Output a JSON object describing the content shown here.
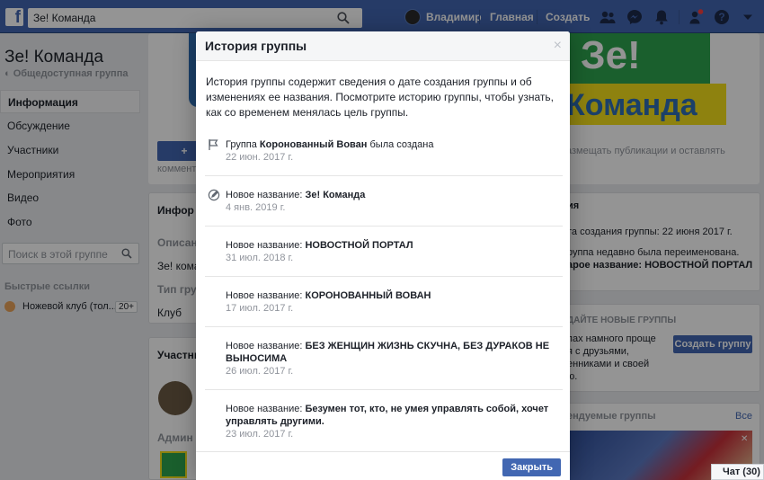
{
  "topbar": {
    "search_value": "Зе! Команда",
    "user_name": "Владимир",
    "home_label": "Главная",
    "create_label": "Создать"
  },
  "left": {
    "group_title": "Зе! Команда",
    "group_type": "Общедоступная группа",
    "nav": [
      "Информация",
      "Обсуждение",
      "Участники",
      "Мероприятия",
      "Видео",
      "Фото"
    ],
    "search_placeholder": "Поиск в этой группе",
    "quick_links_title": "Быстрые ссылки",
    "quick_item": "Ножевой клуб (тол...",
    "quick_badge": "20+"
  },
  "background": {
    "cover_text_top": "Зе!",
    "cover_text_bottom": "Команда",
    "add_btn": "+",
    "comments": "коммент",
    "publish_hint": "азмещать публикации и оставлять",
    "info_card_title": "Инфор",
    "descr_label": "Описан",
    "descr_value": "Зе! кома",
    "type_label": "Тип гру",
    "type_value": "Клуб",
    "members_title": "Участни",
    "admins": "Админ",
    "history_title": "ия",
    "created_line": "та создания группы: 22 июня 2017 г.",
    "renamed_line1": "руппа недавно была переименована.",
    "renamed_line2": "арое название: НОВОСТНОЙ ПОРТАЛ",
    "suggest_title": "ДАЙТЕ НОВЫЕ ГРУППЫ",
    "suggest_l1": "пах намного проще",
    "suggest_l2": "я с друзьями,",
    "suggest_l3": "енниками и своей",
    "suggest_l4": "ю.",
    "create_group_btn": "Создать группу",
    "recommended_title": "ендуемые группы",
    "all_link": "Все",
    "chat_label": "Чат (30)"
  },
  "dialog": {
    "title": "История группы",
    "close": "×",
    "intro": "История группы содержит сведения о дате создания группы и об изменениях ее названия. Посмотрите историю группы, чтобы узнать, как со временем менялась цель группы.",
    "entries": [
      {
        "icon": "flag-icon",
        "prefix": "Группа ",
        "name": "Коронованный Вован",
        "suffix": " была создана",
        "date": "22 июн. 2017 г."
      },
      {
        "icon": "edit-icon",
        "prefix": "Новое название: ",
        "name": "Зе! Команда",
        "suffix": "",
        "date": "4 янв. 2019 г."
      },
      {
        "icon": "",
        "prefix": "Новое название: ",
        "name": "НОВОСТНОЙ ПОРТАЛ",
        "suffix": "",
        "date": "31 июл. 2018 г."
      },
      {
        "icon": "",
        "prefix": "Новое название: ",
        "name": "КОРОНОВАННЫЙ ВОВАН",
        "suffix": "",
        "date": "17 июл. 2017 г."
      },
      {
        "icon": "",
        "prefix": "Новое название: ",
        "name": "БЕЗ ЖЕНЩИН ЖИЗНЬ СКУЧНА, БЕЗ ДУРАКОВ НЕ ВЫНОСИМА",
        "suffix": "",
        "date": "26 июл. 2017 г."
      },
      {
        "icon": "",
        "prefix": "Новое название: ",
        "name": "Безумен тот, кто, не умея управлять собой, хочет управлять другими.",
        "suffix": "",
        "date": "23 июл. 2017 г."
      }
    ],
    "close_button": "Закрыть"
  },
  "colors": {
    "brand": "#4267b2",
    "cover_green": "#2ea44f",
    "cover_yellow": "#f5e11b"
  }
}
